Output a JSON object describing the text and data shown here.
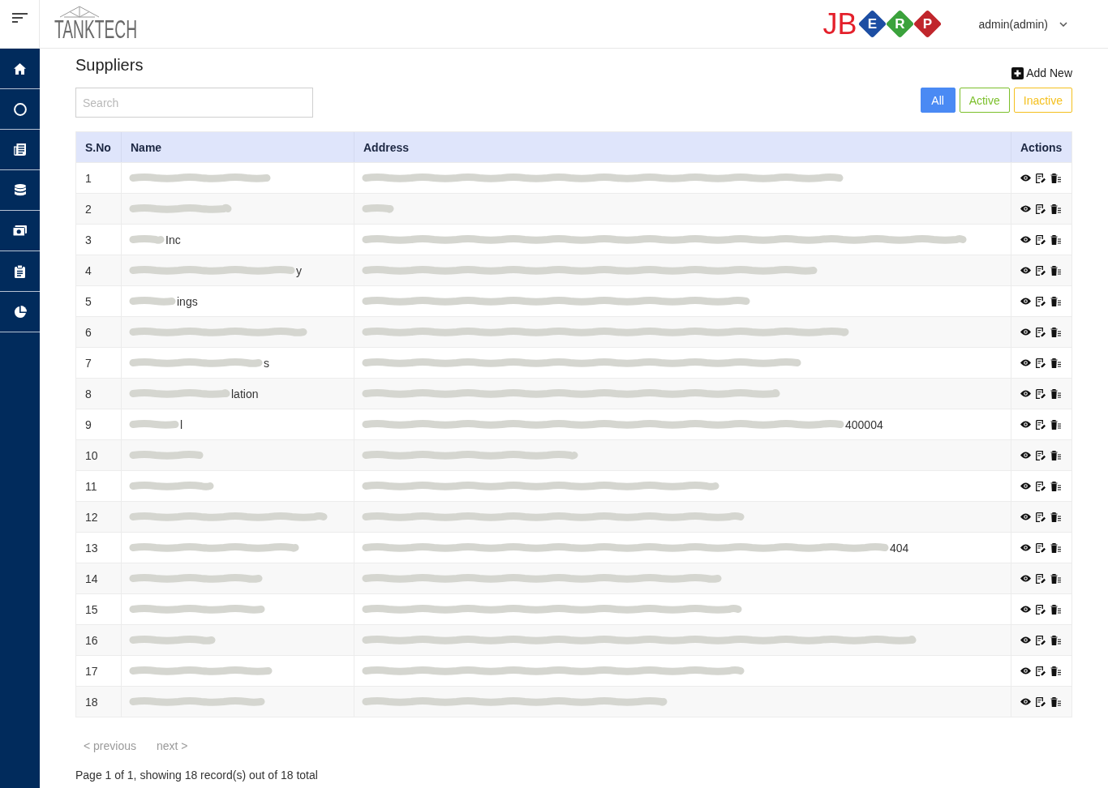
{
  "header": {
    "logo": "TANKTECH",
    "brand": {
      "text": "JB",
      "tiles": [
        {
          "letter": "E",
          "color": "#1d4ea3"
        },
        {
          "letter": "R",
          "color": "#3ba23c"
        },
        {
          "letter": "P",
          "color": "#c0262c"
        }
      ]
    },
    "user": "admin(admin)"
  },
  "sidebar": {
    "items": [
      {
        "kind": "home"
      },
      {
        "kind": "circle"
      },
      {
        "kind": "news"
      },
      {
        "kind": "database"
      },
      {
        "kind": "money"
      },
      {
        "kind": "clipboard"
      },
      {
        "kind": "pie"
      }
    ]
  },
  "page": {
    "title": "Suppliers",
    "search": {
      "placeholder": "Search"
    },
    "add_button": "Add New",
    "filters": [
      {
        "label": "All",
        "selected": true,
        "color": "#4a8af4"
      },
      {
        "label": "Active",
        "selected": false,
        "color": "#7bbf2a"
      },
      {
        "label": "Inactive",
        "selected": false,
        "color": "#f4c01e"
      }
    ]
  },
  "table": {
    "columns": [
      "S.No",
      "Name",
      "Address",
      "Actions"
    ],
    "rows": [
      {
        "sno": "1",
        "name": {
          "redacted": true
        },
        "address": {
          "redacted": true
        }
      },
      {
        "sno": "2",
        "name": {
          "redacted": true
        },
        "address": {
          "redacted": true
        }
      },
      {
        "sno": "3",
        "name": {
          "redacted": true,
          "text": "Inc"
        },
        "address": {
          "redacted": true
        }
      },
      {
        "sno": "4",
        "name": {
          "redacted": true,
          "text": "y"
        },
        "address": {
          "redacted": true
        }
      },
      {
        "sno": "5",
        "name": {
          "redacted": true,
          "text": "ings"
        },
        "address": {
          "redacted": true
        }
      },
      {
        "sno": "6",
        "name": {
          "redacted": true
        },
        "address": {
          "redacted": true
        }
      },
      {
        "sno": "7",
        "name": {
          "redacted": true,
          "text": "s"
        },
        "address": {
          "redacted": true
        }
      },
      {
        "sno": "8",
        "name": {
          "redacted": true,
          "text": "lation"
        },
        "address": {
          "redacted": true
        }
      },
      {
        "sno": "9",
        "name": {
          "redacted": true,
          "text": "l"
        },
        "address": {
          "redacted": true,
          "text": "400004"
        }
      },
      {
        "sno": "10",
        "name": {
          "redacted": true
        },
        "address": {
          "redacted": true
        }
      },
      {
        "sno": "11",
        "name": {
          "redacted": true
        },
        "address": {
          "redacted": true
        }
      },
      {
        "sno": "12",
        "name": {
          "redacted": true
        },
        "address": {
          "redacted": true
        }
      },
      {
        "sno": "13",
        "name": {
          "redacted": true
        },
        "address": {
          "redacted": true,
          "text": "404"
        }
      },
      {
        "sno": "14",
        "name": {
          "redacted": true
        },
        "address": {
          "redacted": true
        }
      },
      {
        "sno": "15",
        "name": {
          "redacted": true
        },
        "address": {
          "redacted": true
        }
      },
      {
        "sno": "16",
        "name": {
          "redacted": true
        },
        "address": {
          "redacted": true
        }
      },
      {
        "sno": "17",
        "name": {
          "redacted": true
        },
        "address": {
          "redacted": true
        }
      },
      {
        "sno": "18",
        "name": {
          "redacted": true
        },
        "address": {
          "redacted": true
        }
      }
    ]
  },
  "pagination": {
    "previous": {
      "label": "< previous",
      "disabled": true
    },
    "next": {
      "label": "next >",
      "disabled": true
    }
  },
  "status": "Page 1 of 1, showing 18 record(s) out of 18 total"
}
